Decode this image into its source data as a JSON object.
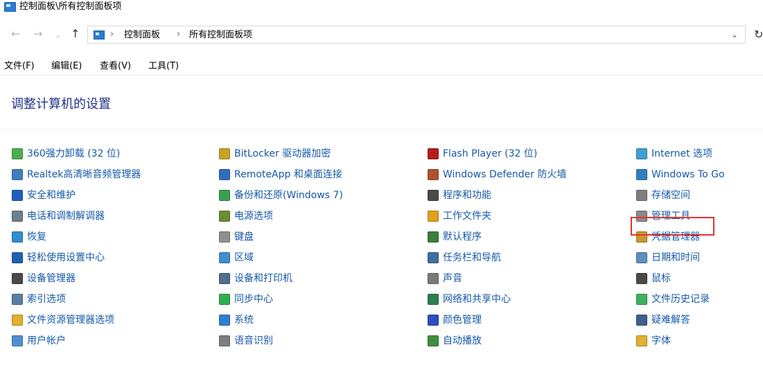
{
  "window": {
    "title": "控制面板\\所有控制面板项"
  },
  "navigation": {
    "back_glyph": "←",
    "forward_glyph": "→",
    "recent_glyph": "⌄",
    "up_glyph": "↑",
    "breadcrumb": [
      "控制面板",
      "所有控制面板项"
    ],
    "separator": "›",
    "dropdown_glyph": "⌄",
    "refresh_glyph": "↻"
  },
  "menu": {
    "file": "文件(F)",
    "edit": "编辑(E)",
    "view": "查看(V)",
    "tools": "工具(T)"
  },
  "content": {
    "heading": "调整计算机的设置"
  },
  "items": {
    "col1": [
      {
        "label": "360强力卸载 (32 位)",
        "icon": "uninstall-icon",
        "color": "#4caf50"
      },
      {
        "label": "Realtek高清晰音频管理器",
        "icon": "audio-manager-icon",
        "color": "#3f7fbf"
      },
      {
        "label": "安全和维护",
        "icon": "flag-icon",
        "color": "#1f5fbf"
      },
      {
        "label": "电话和调制解调器",
        "icon": "phone-modem-icon",
        "color": "#6f7f8f"
      },
      {
        "label": "恢复",
        "icon": "recovery-icon",
        "color": "#2f8fcf"
      },
      {
        "label": "轻松使用设置中心",
        "icon": "ease-of-access-icon",
        "color": "#2060b0"
      },
      {
        "label": "设备管理器",
        "icon": "device-manager-icon",
        "color": "#4a4a4a"
      },
      {
        "label": "索引选项",
        "icon": "indexing-icon",
        "color": "#5a7fa0"
      },
      {
        "label": "文件资源管理器选项",
        "icon": "folder-options-icon",
        "color": "#e0b030"
      },
      {
        "label": "用户帐户",
        "icon": "user-accounts-icon",
        "color": "#4f8fd0"
      }
    ],
    "col2": [
      {
        "label": "BitLocker 驱动器加密",
        "icon": "bitlocker-icon",
        "color": "#c9a227"
      },
      {
        "label": "RemoteApp 和桌面连接",
        "icon": "remoteapp-icon",
        "color": "#2f6fbf"
      },
      {
        "label": "备份和还原(Windows 7)",
        "icon": "backup-icon",
        "color": "#3aa050"
      },
      {
        "label": "电源选项",
        "icon": "power-icon",
        "color": "#6a8f30"
      },
      {
        "label": "键盘",
        "icon": "keyboard-icon",
        "color": "#8f8f8f"
      },
      {
        "label": "区域",
        "icon": "region-icon",
        "color": "#3f8fcf"
      },
      {
        "label": "设备和打印机",
        "icon": "printer-icon",
        "color": "#4f6f8f"
      },
      {
        "label": "同步中心",
        "icon": "sync-icon",
        "color": "#2faf4f"
      },
      {
        "label": "系统",
        "icon": "system-icon",
        "color": "#2f7fd0"
      },
      {
        "label": "语音识别",
        "icon": "microphone-icon",
        "color": "#7f7f7f"
      }
    ],
    "col3": [
      {
        "label": "Flash Player (32 位)",
        "icon": "flash-icon",
        "color": "#b71c1c"
      },
      {
        "label": "Windows Defender 防火墙",
        "icon": "firewall-icon",
        "color": "#b0502f"
      },
      {
        "label": "程序和功能",
        "icon": "programs-icon",
        "color": "#4a4a4a"
      },
      {
        "label": "工作文件夹",
        "icon": "work-folders-icon",
        "color": "#e0a020"
      },
      {
        "label": "默认程序",
        "icon": "default-programs-icon",
        "color": "#3a7f3a"
      },
      {
        "label": "任务栏和导航",
        "icon": "taskbar-icon",
        "color": "#3f6fa0"
      },
      {
        "label": "声音",
        "icon": "speaker-icon",
        "color": "#7a7a7a"
      },
      {
        "label": "网络和共享中心",
        "icon": "network-icon",
        "color": "#2f7f4f"
      },
      {
        "label": "颜色管理",
        "icon": "color-management-icon",
        "color": "#2f4fbf"
      },
      {
        "label": "自动播放",
        "icon": "autoplay-icon",
        "color": "#3f8f3f"
      }
    ],
    "col4": [
      {
        "label": "Internet 选项",
        "icon": "internet-options-icon",
        "color": "#3f9fd0"
      },
      {
        "label": "Windows To Go",
        "icon": "windows-to-go-icon",
        "color": "#2f7fbf"
      },
      {
        "label": "存储空间",
        "icon": "storage-spaces-icon",
        "color": "#7f7f7f"
      },
      {
        "label": "管理工具",
        "icon": "admin-tools-icon",
        "color": "#8a8a8a"
      },
      {
        "label": "凭据管理器",
        "icon": "credential-icon",
        "color": "#c99a2f"
      },
      {
        "label": "日期和时间",
        "icon": "clock-icon",
        "color": "#5f8fbf"
      },
      {
        "label": "鼠标",
        "icon": "mouse-icon",
        "color": "#4a4a4a"
      },
      {
        "label": "文件历史记录",
        "icon": "file-history-icon",
        "color": "#3faf5f"
      },
      {
        "label": "疑难解答",
        "icon": "troubleshooting-icon",
        "color": "#3f5f8f"
      },
      {
        "label": "字体",
        "icon": "fonts-icon",
        "color": "#e0b030"
      }
    ]
  },
  "highlight": {
    "target": "管理工具",
    "color": "#e5322d"
  }
}
